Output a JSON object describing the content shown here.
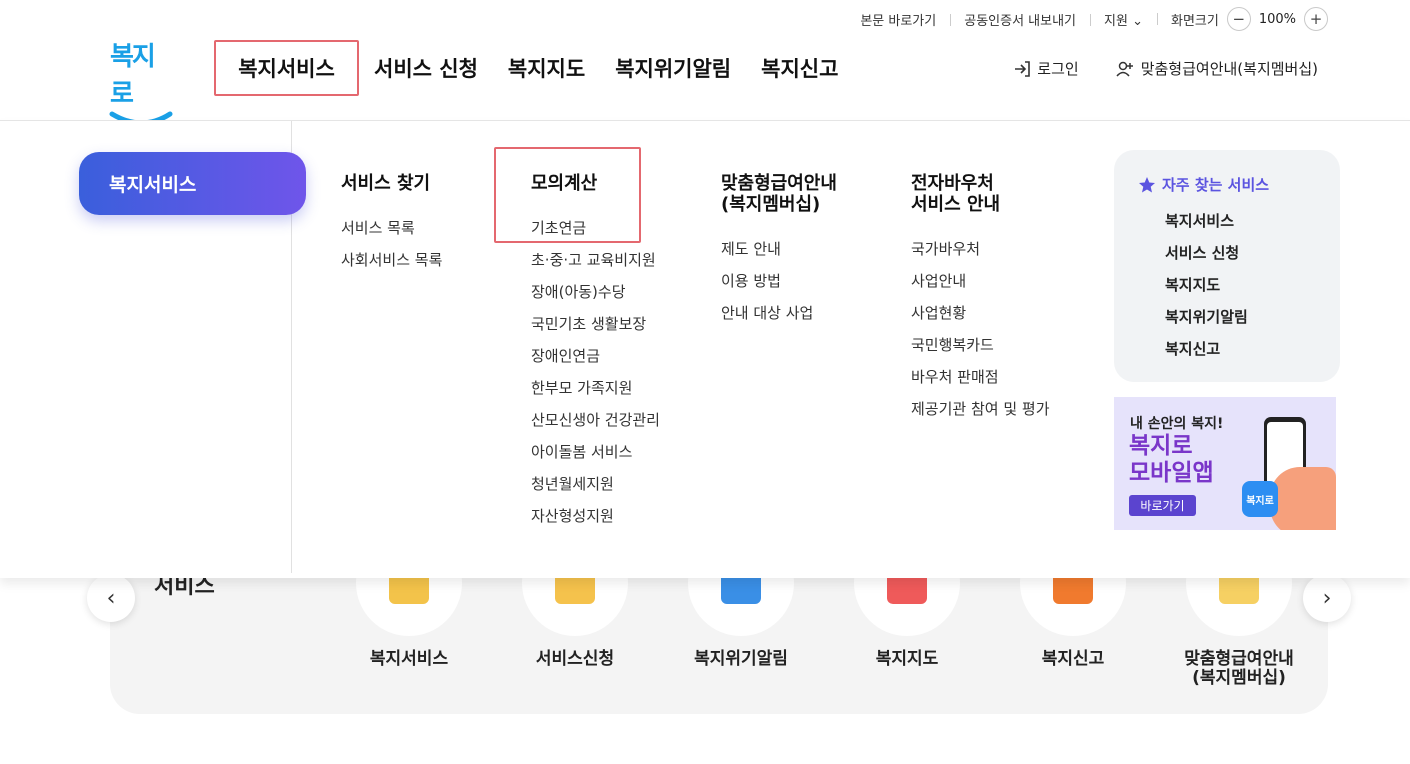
{
  "utility": {
    "skip_content": "본문 바로가기",
    "cert_export": "공동인증서 내보내기",
    "support": "지원",
    "zoom_label": "화면크기",
    "zoom_value": "100%",
    "zoom_out": "−",
    "zoom_in": "+"
  },
  "logo": {
    "text": "복지로"
  },
  "gnb": [
    "복지서비스",
    "서비스 신청",
    "복지지도",
    "복지위기알림",
    "복지신고"
  ],
  "header_right": {
    "login": "로그인",
    "membership": "맞춤형급여안내(복지멤버십)"
  },
  "mega": {
    "title": "복지서비스",
    "columns": [
      {
        "heading": "서비스 찾기",
        "items": [
          "서비스 목록",
          "사회서비스 목록"
        ]
      },
      {
        "heading": "모의계산",
        "items": [
          "기초연금",
          "초·중·고 교육비지원",
          "장애(아동)수당",
          "국민기초 생활보장",
          "장애인연금",
          "한부모 가족지원",
          "산모신생아 건강관리",
          "아이돌봄 서비스",
          "청년월세지원",
          "자산형성지원"
        ]
      },
      {
        "heading": "맞춤형급여안내\n(복지멤버십)",
        "items": [
          "제도 안내",
          "이용 방법",
          "안내 대상 사업"
        ]
      },
      {
        "heading": "전자바우처\n서비스 안내",
        "items": [
          "국가바우처",
          "사업안내",
          "사업현황",
          "국민행복카드",
          "바우처 판매점",
          "제공기관 참여 및 평가"
        ]
      }
    ],
    "favorites": {
      "heading": "자주 찾는 서비스",
      "items": [
        "복지서비스",
        "서비스 신청",
        "복지지도",
        "복지위기알림",
        "복지신고"
      ]
    },
    "banner": {
      "line1": "내 손안의 복지!",
      "line2": "복지로\n모바일앱",
      "button": "바로가기",
      "app_icon": "복지로"
    }
  },
  "services": {
    "title": "서비스",
    "prev": "‹",
    "next": "›",
    "items": [
      "복지서비스",
      "서비스신청",
      "복지위기알림",
      "복지지도",
      "복지신고",
      "맞춤형급여안내\n(복지멤버십)"
    ]
  },
  "colors": {
    "accent": "#5b54e0",
    "gradient_start": "#3a5fdc",
    "gradient_end": "#6f55ea",
    "highlight": "#e4686f",
    "logo": "#1aa0e6"
  }
}
